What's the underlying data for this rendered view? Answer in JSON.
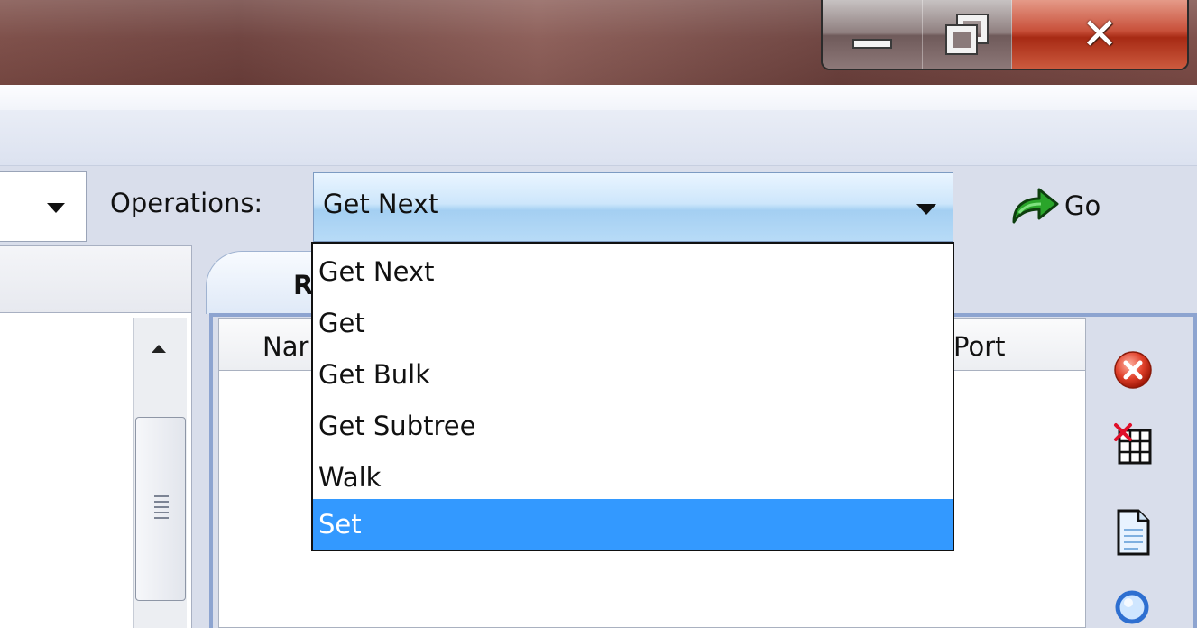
{
  "window": {
    "controls": {
      "minimize_icon": "minimize-icon",
      "maximize_icon": "restore-icon",
      "close_icon": "close-icon"
    }
  },
  "toolbar": {
    "operations_label": "Operations:",
    "operations_selected": "Get Next",
    "go_label": "Go"
  },
  "operations_dropdown": {
    "items": [
      "Get Next",
      "Get",
      "Get Bulk",
      "Get Subtree",
      "Walk",
      "Set"
    ],
    "highlighted": "Set"
  },
  "tabs": [
    {
      "label": "R"
    }
  ],
  "table": {
    "columns": [
      "Nar",
      "Port"
    ]
  },
  "side_buttons": [
    "delete-icon",
    "clear-table-icon",
    "document-icon",
    "search-icon"
  ],
  "colors": {
    "highlight": "#3399ff",
    "go_arrow": "#2aa52a",
    "delete": "#e0402a"
  }
}
